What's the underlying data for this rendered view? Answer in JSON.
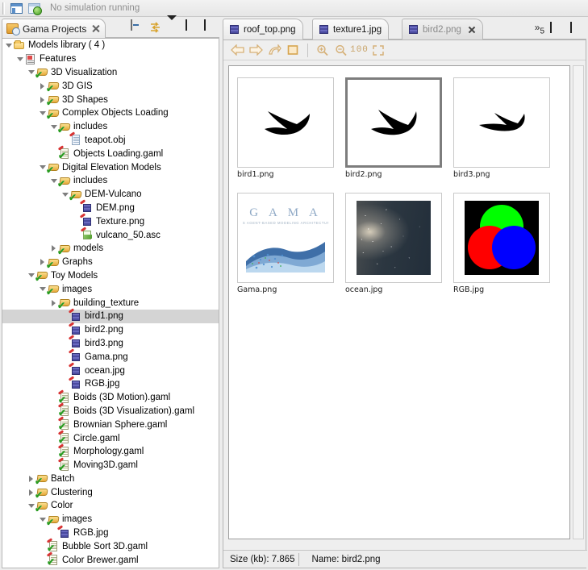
{
  "coolbar": {
    "icons": [
      "perspective-icon",
      "run-simulation-icon"
    ],
    "status_text": "No simulation running"
  },
  "explorer": {
    "tab_label": "Gama Projects",
    "toolbar": [
      "collapse-all-icon",
      "link-with-editor-icon",
      "view-menu-icon",
      "minimize-icon",
      "maximize-icon"
    ],
    "tree": [
      {
        "label": "Models library ( 4 )",
        "depth": 0,
        "twist": "open",
        "icon": "folder-plain",
        "selected": false
      },
      {
        "label": "Features",
        "depth": 1,
        "twist": "open",
        "icon": "project",
        "selected": false
      },
      {
        "label": "3D Visualization",
        "depth": 2,
        "twist": "open",
        "icon": "folder-check",
        "selected": false
      },
      {
        "label": "3D GIS",
        "depth": 3,
        "twist": "closed",
        "icon": "folder-check",
        "selected": false
      },
      {
        "label": "3D Shapes",
        "depth": 3,
        "twist": "closed",
        "icon": "folder-check",
        "selected": false
      },
      {
        "label": "Complex Objects Loading",
        "depth": 3,
        "twist": "open",
        "icon": "folder-check",
        "selected": false
      },
      {
        "label": "includes",
        "depth": 4,
        "twist": "open",
        "icon": "folder-check",
        "selected": false
      },
      {
        "label": "teapot.obj",
        "depth": 5,
        "twist": "none",
        "icon": "obj-file",
        "selected": false
      },
      {
        "label": "Objects Loading.gaml",
        "depth": 4,
        "twist": "none",
        "icon": "gaml-file",
        "selected": false
      },
      {
        "label": "Digital Elevation Models",
        "depth": 3,
        "twist": "open",
        "icon": "folder-check",
        "selected": false
      },
      {
        "label": "includes",
        "depth": 4,
        "twist": "open",
        "icon": "folder-check",
        "selected": false
      },
      {
        "label": "DEM-Vulcano",
        "depth": 5,
        "twist": "open",
        "icon": "folder-check",
        "selected": false
      },
      {
        "label": "DEM.png",
        "depth": 6,
        "twist": "none",
        "icon": "image-file",
        "selected": false
      },
      {
        "label": "Texture.png",
        "depth": 6,
        "twist": "none",
        "icon": "image-file",
        "selected": false
      },
      {
        "label": "vulcano_50.asc",
        "depth": 6,
        "twist": "none",
        "icon": "asc-file",
        "selected": false
      },
      {
        "label": "models",
        "depth": 4,
        "twist": "closed",
        "icon": "folder-check",
        "selected": false
      },
      {
        "label": "Graphs",
        "depth": 3,
        "twist": "closed",
        "icon": "folder-check",
        "selected": false
      },
      {
        "label": "Toy Models",
        "depth": 2,
        "twist": "open",
        "icon": "folder-check",
        "selected": false
      },
      {
        "label": "images",
        "depth": 3,
        "twist": "open",
        "icon": "folder-check",
        "selected": false
      },
      {
        "label": "building_texture",
        "depth": 4,
        "twist": "closed",
        "icon": "folder-check",
        "selected": false
      },
      {
        "label": "bird1.png",
        "depth": 5,
        "twist": "none",
        "icon": "image-file",
        "selected": true
      },
      {
        "label": "bird2.png",
        "depth": 5,
        "twist": "none",
        "icon": "image-file",
        "selected": false
      },
      {
        "label": "bird3.png",
        "depth": 5,
        "twist": "none",
        "icon": "image-file",
        "selected": false
      },
      {
        "label": "Gama.png",
        "depth": 5,
        "twist": "none",
        "icon": "image-file",
        "selected": false
      },
      {
        "label": "ocean.jpg",
        "depth": 5,
        "twist": "none",
        "icon": "image-file",
        "selected": false
      },
      {
        "label": "RGB.jpg",
        "depth": 5,
        "twist": "none",
        "icon": "image-file",
        "selected": false
      },
      {
        "label": "Boids (3D Motion).gaml",
        "depth": 4,
        "twist": "none",
        "icon": "gaml-file",
        "selected": false
      },
      {
        "label": "Boids (3D Visualization).gaml",
        "depth": 4,
        "twist": "none",
        "icon": "gaml-file",
        "selected": false
      },
      {
        "label": "Brownian Sphere.gaml",
        "depth": 4,
        "twist": "none",
        "icon": "gaml-file",
        "selected": false
      },
      {
        "label": "Circle.gaml",
        "depth": 4,
        "twist": "none",
        "icon": "gaml-file",
        "selected": false
      },
      {
        "label": "Morphology.gaml",
        "depth": 4,
        "twist": "none",
        "icon": "gaml-file",
        "selected": false
      },
      {
        "label": "Moving3D.gaml",
        "depth": 4,
        "twist": "none",
        "icon": "gaml-file",
        "selected": false
      },
      {
        "label": "Batch",
        "depth": 2,
        "twist": "closed",
        "icon": "folder-check",
        "selected": false
      },
      {
        "label": "Clustering",
        "depth": 2,
        "twist": "closed",
        "icon": "folder-check",
        "selected": false
      },
      {
        "label": "Color",
        "depth": 2,
        "twist": "open",
        "icon": "folder-check",
        "selected": false
      },
      {
        "label": "images",
        "depth": 3,
        "twist": "open",
        "icon": "folder-check",
        "selected": false
      },
      {
        "label": "RGB.jpg",
        "depth": 4,
        "twist": "none",
        "icon": "image-file",
        "selected": false
      },
      {
        "label": "Bubble Sort 3D.gaml",
        "depth": 3,
        "twist": "none",
        "icon": "gaml-file",
        "selected": false
      },
      {
        "label": "Color Brewer.gaml",
        "depth": 3,
        "twist": "none",
        "icon": "gaml-file",
        "selected": false
      }
    ]
  },
  "editor": {
    "tabs": [
      {
        "label": "roof_top.png",
        "active": false,
        "closable": false
      },
      {
        "label": "texture1.jpg",
        "active": false,
        "closable": false
      },
      {
        "label": "bird2.png",
        "active": true,
        "closable": true
      }
    ],
    "overflow_label": "»",
    "overflow_count": "5",
    "window_controls": [
      "minimize-icon",
      "maximize-icon"
    ],
    "image_toolbar": [
      "back-arrow-icon",
      "forward-arrow-icon",
      "refresh-arrow-icon",
      "stop-square-icon",
      "zoom-in-icon",
      "zoom-out-icon",
      "zoom-100-label",
      "fit-to-window-icon"
    ],
    "zoom_100_label": "100",
    "thumbnails": [
      {
        "label": "bird1.png",
        "kind": "bird1",
        "selected": false
      },
      {
        "label": "bird2.png",
        "kind": "bird2",
        "selected": true
      },
      {
        "label": "bird3.png",
        "kind": "bird3",
        "selected": false
      },
      {
        "label": "Gama.png",
        "kind": "gama",
        "selected": false
      },
      {
        "label": "ocean.jpg",
        "kind": "ocean",
        "selected": false
      },
      {
        "label": "RGB.jpg",
        "kind": "rgb",
        "selected": false
      }
    ],
    "gama_wordmark": "G A M A"
  },
  "statusbar": {
    "size_label": "Size (kb): 7.865",
    "name_label": "Name: bird2.png"
  },
  "colors": {
    "selection_gray": "#d4d4d4",
    "panel_bg": "#ededed",
    "toolbar_icon": "#d6b179",
    "thumb_selected_border": "#7d7d7d"
  }
}
